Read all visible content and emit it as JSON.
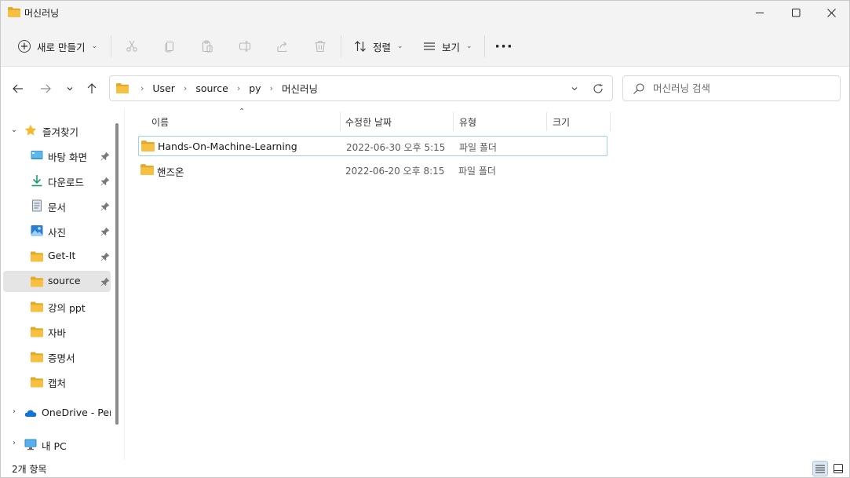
{
  "window": {
    "title": "머신러닝",
    "controls": {
      "minimize": "—",
      "maximize": "☐",
      "close": "✕"
    }
  },
  "toolbar": {
    "new_label": "새로 만들기",
    "sort_label": "정렬",
    "view_label": "보기",
    "more_label": "···",
    "icons": [
      "cut-icon",
      "copy-icon",
      "paste-icon",
      "rename-icon",
      "share-icon",
      "delete-icon"
    ]
  },
  "address": {
    "breadcrumbs": [
      "User",
      "source",
      "py",
      "머신러닝"
    ]
  },
  "search": {
    "placeholder": "머신러닝 검색"
  },
  "sidebar": {
    "quick_access_label": "즐겨찾기",
    "items": [
      {
        "label": "바탕 화면",
        "icon": "desktop-icon",
        "pinned": true
      },
      {
        "label": "다운로드",
        "icon": "download-icon",
        "pinned": true
      },
      {
        "label": "문서",
        "icon": "document-icon",
        "pinned": true
      },
      {
        "label": "사진",
        "icon": "pictures-icon",
        "pinned": true
      },
      {
        "label": "Get-It",
        "icon": "folder-icon",
        "pinned": true
      },
      {
        "label": "source",
        "icon": "folder-icon",
        "pinned": true,
        "selected": true
      },
      {
        "label": "강의 ppt",
        "icon": "folder-icon",
        "pinned": false
      },
      {
        "label": "자바",
        "icon": "folder-icon",
        "pinned": false
      },
      {
        "label": "증명서",
        "icon": "folder-icon",
        "pinned": false
      },
      {
        "label": "캡처",
        "icon": "folder-icon",
        "pinned": false
      }
    ],
    "onedrive_label": "OneDrive - Perso",
    "thispc_label": "내 PC"
  },
  "table": {
    "columns": {
      "name": "이름",
      "modified": "수정한 날짜",
      "type": "유형",
      "size": "크기"
    },
    "rows": [
      {
        "name": "Hands-On-Machine-Learning",
        "modified": "2022-06-30 오후 5:15",
        "type": "파일 폴더",
        "size": ""
      },
      {
        "name": "핸즈온",
        "modified": "2022-06-20 오후 8:15",
        "type": "파일 폴더",
        "size": ""
      }
    ]
  },
  "status": {
    "item_count": "2개 항목"
  },
  "colors": {
    "folder": "#f6c143",
    "folder_dark": "#e5a92a",
    "accent": "#0067c0",
    "selected_bg": "#e5e5e5",
    "focus_border": "#9fd5d9"
  }
}
